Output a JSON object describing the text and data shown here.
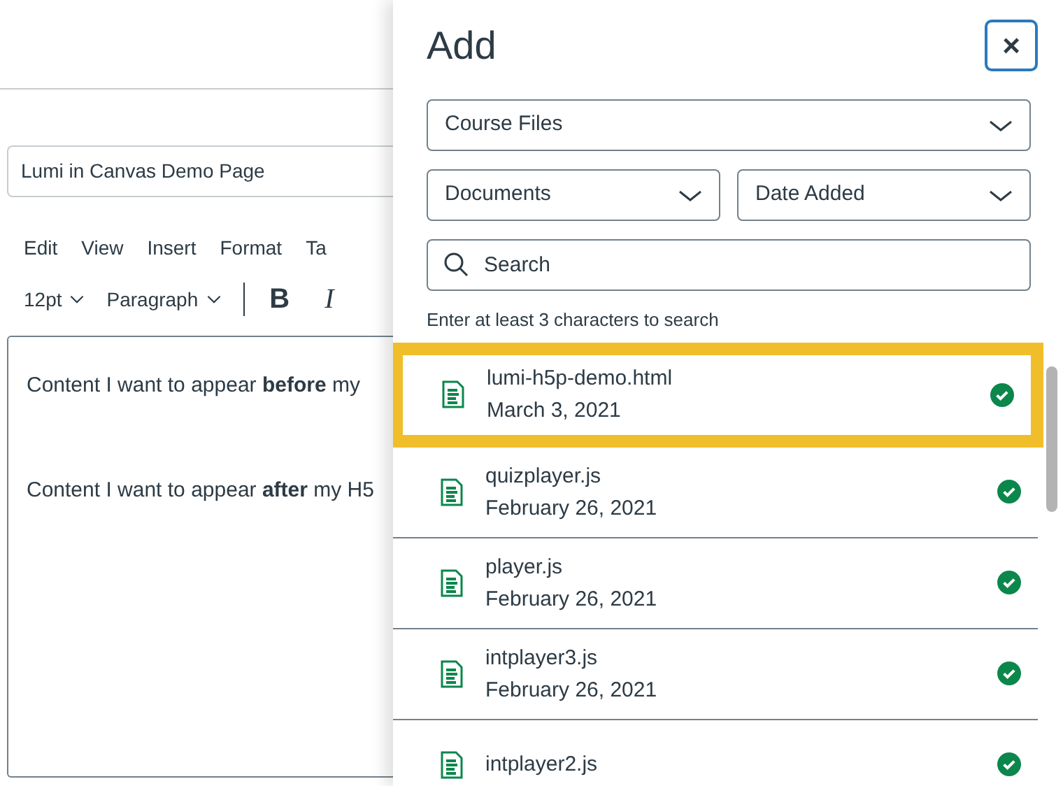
{
  "editor": {
    "title_value": "Lumi in Canvas Demo Page",
    "menu": [
      "Edit",
      "View",
      "Insert",
      "Format",
      "Ta"
    ],
    "font_size": "12pt",
    "block_format": "Paragraph",
    "format_buttons": [
      {
        "label": "B",
        "kind": "bold"
      },
      {
        "label": "I",
        "kind": "italic"
      }
    ],
    "paragraphs": [
      "Content I want to appear **before** my",
      "Content I want to appear **after** my H5"
    ]
  },
  "tray": {
    "title": "Add",
    "close_label": "×",
    "source": "Course Files",
    "type": "Documents",
    "sort": "Date Added",
    "search": {
      "placeholder": "Search"
    },
    "hint": "Enter at least 3 characters to search",
    "files": [
      {
        "name": "lumi-h5p-demo.html",
        "date": "March 3, 2021",
        "selected": true
      },
      {
        "name": "quizplayer.js",
        "date": "February 26, 2021",
        "selected": false
      },
      {
        "name": "player.js",
        "date": "February 26, 2021",
        "selected": false
      },
      {
        "name": "intplayer3.js",
        "date": "February 26, 2021",
        "selected": false
      },
      {
        "name": "intplayer2.js",
        "selected": false
      }
    ]
  }
}
